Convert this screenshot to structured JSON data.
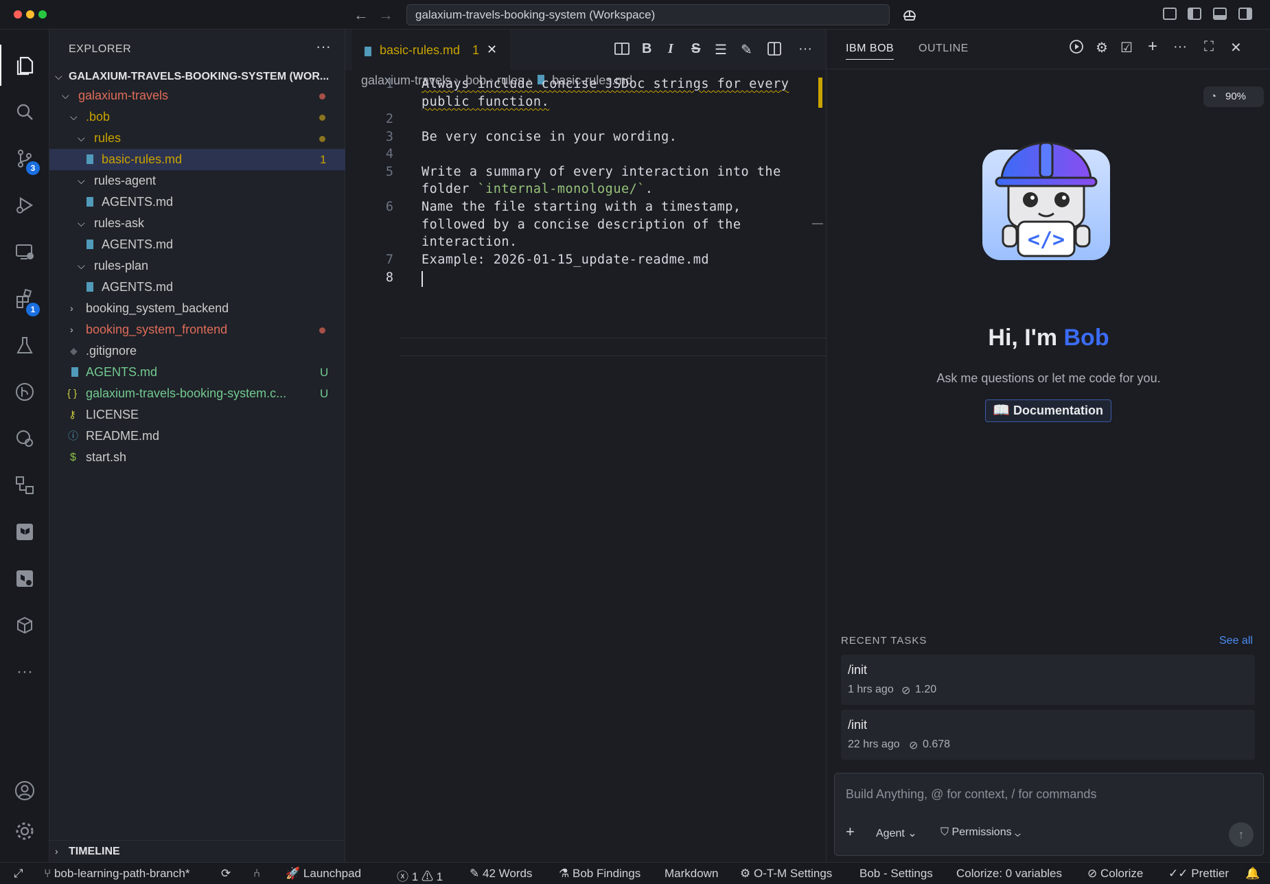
{
  "window": {
    "command_center": "galaxium-travels-booking-system (Workspace)",
    "nav_back": "←",
    "nav_forward": "→"
  },
  "activity_bar": {
    "source_control_badge": "3",
    "extensions_badge": "1",
    "more": "···"
  },
  "explorer": {
    "title": "EXPLORER",
    "more": "···",
    "workspace_root": "GALAXIUM-TRAVELS-BOOKING-SYSTEM (WOR...",
    "items": [
      {
        "name": "galaxium-travels",
        "status": ""
      },
      {
        "name": ".bob",
        "status": ""
      },
      {
        "name": "rules",
        "status": ""
      },
      {
        "name": "basic-rules.md",
        "status": "1"
      },
      {
        "name": "rules-agent",
        "status": ""
      },
      {
        "name": "AGENTS.md",
        "status": ""
      },
      {
        "name": "rules-ask",
        "status": ""
      },
      {
        "name": "AGENTS.md",
        "status": ""
      },
      {
        "name": "rules-plan",
        "status": ""
      },
      {
        "name": "AGENTS.md",
        "status": ""
      },
      {
        "name": "booking_system_backend",
        "status": ""
      },
      {
        "name": "booking_system_frontend",
        "status": ""
      },
      {
        "name": ".gitignore",
        "status": ""
      },
      {
        "name": "AGENTS.md",
        "status": "U"
      },
      {
        "name": "galaxium-travels-booking-system.c...",
        "status": "U"
      },
      {
        "name": "LICENSE",
        "status": ""
      },
      {
        "name": "README.md",
        "status": ""
      },
      {
        "name": "start.sh",
        "status": ""
      }
    ],
    "timeline": "TIMELINE"
  },
  "editor": {
    "tab": {
      "label": "basic-rules.md",
      "problems": "1",
      "close": "✕"
    },
    "toolbar_more": "···",
    "breadcrumb": [
      "galaxium-travels",
      ".bob",
      "rules",
      "basic-rules.md"
    ],
    "lines": {
      "n1": "1",
      "n2": "2",
      "n3": "3",
      "n4": "4",
      "n5": "5",
      "n6": "6",
      "n7": "7",
      "n8": "8",
      "l1a": "Always include concise JSDoc strings for every",
      "l1b": "public function.",
      "l3": "Be very concise in your wording.",
      "l5a": "Write a summary of every interaction into the",
      "l5b_pre": "folder ",
      "l5b_code": "`internal-monologue/`",
      "l5b_post": ".",
      "l6a": "Name the file starting with a timestamp,",
      "l6b": "followed by a concise description of the",
      "l6c": "interaction.",
      "l7": "Example: 2026-01-15_update-readme.md"
    }
  },
  "bob_panel": {
    "tab_active": "IBM BOB",
    "tab_outline": "OUTLINE",
    "more": "···",
    "zoom": "90%",
    "greeting_prefix": "Hi, I'm ",
    "greeting_name": "Bob",
    "subtitle": "Ask me questions or let me code for you.",
    "doc_button": "Documentation",
    "recent_title": "RECENT TASKS",
    "see_all": "See all",
    "tasks": [
      {
        "name": "/init",
        "time": "1 hrs ago",
        "cost": "1.20"
      },
      {
        "name": "/init",
        "time": "22 hrs ago",
        "cost": "0.678"
      }
    ],
    "chat": {
      "placeholder": "Build Anything, @ for context, / for commands",
      "plus": "+",
      "mode": "Agent",
      "permissions": "Permissions",
      "send": "↑"
    }
  },
  "colors": {
    "accent": "#2f6fed",
    "bob_blue": "#3b6cf6",
    "modified": "#e06c5a",
    "untracked": "#73c991",
    "warning": "#c9a300"
  },
  "statusbar": {
    "branch": "bob-learning-path-branch*",
    "launchpad": "Launchpad",
    "errors": "1",
    "warnings": "1",
    "words": "42 Words",
    "findings": "Bob Findings",
    "language": "Markdown",
    "otm": "O-T-M Settings",
    "bob_settings": "Bob - Settings",
    "colorize_vars": "Colorize: 0 variables",
    "colorize": "Colorize",
    "prettier": "Prettier"
  }
}
